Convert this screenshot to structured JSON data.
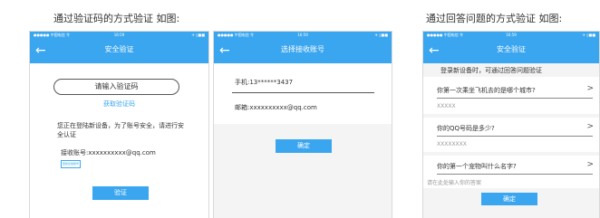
{
  "captions": {
    "left": "通过验证码的方式验证 如图:",
    "right": "通过回答问题的方式验证 如图:"
  },
  "status_bar": {
    "carrier": "●●●●● 中国电信 令",
    "time": "16:59",
    "battery": "✈ ▯■■"
  },
  "phone1": {
    "title": "安全验证",
    "code_input_placeholder": "请输入验证码",
    "get_code_link": "获取验证码",
    "notice": "您正在登陆新设备，为了账号安全，请进行安全认证",
    "receive_account": "接收账号:xxxxxxxxxx@qq.com",
    "change_account": "更换接收账号",
    "verify_button": "验证"
  },
  "phone2": {
    "title": "选择接收账号",
    "phone_option": "手机:13******3437",
    "email_option": "邮箱:xxxxxxxxxx@qq.com",
    "confirm_button": "确定"
  },
  "phone3": {
    "title": "安全验证",
    "intro": "登录新设备时，可通过回答问题验证",
    "questions": [
      {
        "question": "你第一次乘坐飞机去的是哪个城市?",
        "answer": "XXXXX"
      },
      {
        "question": "你的QQ号码是多少?",
        "answer": "XXXXXXXX"
      },
      {
        "question": "你的第一个宠物叫什么名字?",
        "answer": "请在此处输入你的答案"
      }
    ],
    "confirm_button": "确定"
  },
  "colors": {
    "accent": "#3aa6ef",
    "border": "#d9d9d9",
    "text": "#333333",
    "muted": "#999999"
  },
  "icons": {
    "back": "left-arrow-icon",
    "chevron": "chevron-right-icon"
  }
}
